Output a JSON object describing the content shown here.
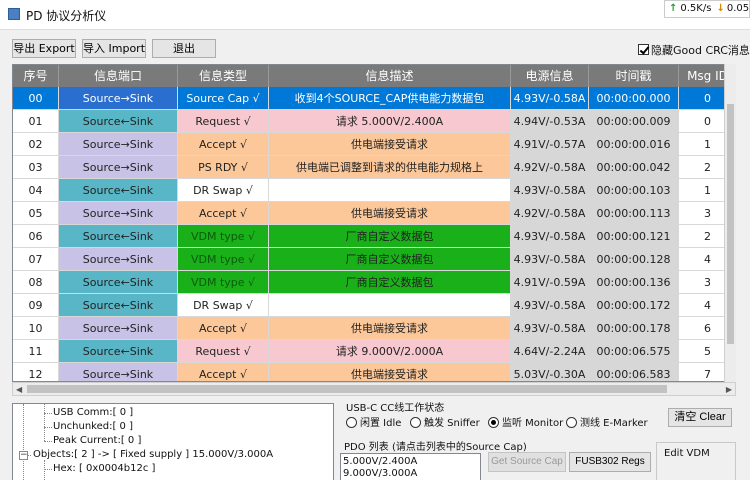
{
  "window": {
    "title": "PD 协议分析仪",
    "net_up": "0.5K/s",
    "net_down": "0.05"
  },
  "toolbar": {
    "export_label": "导出 Export",
    "import_label": "导入 Import",
    "exit_label": "退出",
    "hide_crc_label": "隐藏Good CRC消息",
    "hide_crc_checked": true
  },
  "table": {
    "columns": [
      "序号",
      "信息端口",
      "信息类型",
      "信息描述",
      "电源信息",
      "时间戳",
      "Msg ID"
    ],
    "rows": [
      {
        "no": "00",
        "port": "Source→Sink",
        "type": "Source Cap √",
        "desc": "收到4个SOURCE_CAP供电能力数据包",
        "power": "4.93V/-0.58A",
        "time": "00:00:00.000",
        "msg_id": "0",
        "selected": true
      },
      {
        "no": "01",
        "port": "Source←Sink",
        "type": "Request √",
        "desc": "请求 5.000V/2.400A",
        "power": "4.94V/-0.53A",
        "time": "00:00:00.009",
        "msg_id": "0"
      },
      {
        "no": "02",
        "port": "Source→Sink",
        "type": "Accept √",
        "desc": "供电端接受请求",
        "power": "4.91V/-0.57A",
        "time": "00:00:00.016",
        "msg_id": "1"
      },
      {
        "no": "03",
        "port": "Source→Sink",
        "type": "PS RDY √",
        "desc": "供电端已调整到请求的供电能力规格上",
        "power": "4.92V/-0.58A",
        "time": "00:00:00.042",
        "msg_id": "2"
      },
      {
        "no": "04",
        "port": "Source←Sink",
        "type": "DR Swap √",
        "desc": "",
        "power": "4.93V/-0.58A",
        "time": "00:00:00.103",
        "msg_id": "1"
      },
      {
        "no": "05",
        "port": "Source→Sink",
        "type": "Accept √",
        "desc": "供电端接受请求",
        "power": "4.92V/-0.58A",
        "time": "00:00:00.113",
        "msg_id": "3"
      },
      {
        "no": "06",
        "port": "Source←Sink",
        "type": "VDM type √",
        "desc": "厂商自定义数据包",
        "power": "4.93V/-0.58A",
        "time": "00:00:00.121",
        "msg_id": "2"
      },
      {
        "no": "07",
        "port": "Source→Sink",
        "type": "VDM type √",
        "desc": "厂商自定义数据包",
        "power": "4.93V/-0.58A",
        "time": "00:00:00.128",
        "msg_id": "4"
      },
      {
        "no": "08",
        "port": "Source←Sink",
        "type": "VDM type √",
        "desc": "厂商自定义数据包",
        "power": "4.91V/-0.59A",
        "time": "00:00:00.136",
        "msg_id": "3"
      },
      {
        "no": "09",
        "port": "Source←Sink",
        "type": "DR Swap √",
        "desc": "",
        "power": "4.93V/-0.58A",
        "time": "00:00:00.172",
        "msg_id": "4"
      },
      {
        "no": "10",
        "port": "Source→Sink",
        "type": "Accept √",
        "desc": "供电端接受请求",
        "power": "4.93V/-0.58A",
        "time": "00:00:00.178",
        "msg_id": "6"
      },
      {
        "no": "11",
        "port": "Source←Sink",
        "type": "Request √",
        "desc": "请求 9.000V/2.000A",
        "power": "4.64V/-2.24A",
        "time": "00:00:06.575",
        "msg_id": "5"
      },
      {
        "no": "12",
        "port": "Source→Sink",
        "type": "Accept √",
        "desc": "供电端接受请求",
        "power": "5.03V/-0.30A",
        "time": "00:00:06.583",
        "msg_id": "7"
      }
    ]
  },
  "colors": {
    "header_bg": "#7a7a7a",
    "selected_bg": "#0078d7",
    "port_to_sink": "#c7c2e6",
    "port_from_sink": "#59b6c6",
    "type_source_cap": "#0078d7",
    "type_request": "#f8c8d0",
    "type_accept": "#fcc89a",
    "type_ps_rdy": "#fcc89a",
    "type_vdm": "#1ab01a",
    "type_dr_swap": "#ffffff",
    "desc_source_cap": "#0078d7",
    "desc_request": "#f8c8d0",
    "desc_accept": "#fcc89a",
    "desc_ps_rdy": "#fcc89a",
    "desc_vdm": "#1ab01a",
    "power_bg": "#d7d7d7"
  },
  "tree": {
    "lines": [
      "USB Comm:[ 0 ]",
      "Unchunked:[ 0 ]",
      "Peak Current:[ 0 ]",
      "Objects:[ 2 ] -> [ Fixed supply ] 15.000V/3.000A",
      "Hex: [ 0x0004b12c ]"
    ]
  },
  "cc_status": {
    "title": "USB-C CC线工作状态",
    "options": [
      {
        "label": "闲置 Idle",
        "selected": false
      },
      {
        "label": "触发 Sniffer",
        "selected": false
      },
      {
        "label": "监听 Monitor",
        "selected": true
      },
      {
        "label": "测线 E-Marker",
        "selected": false
      }
    ],
    "clear_label": "清空 Clear"
  },
  "pdo": {
    "title": "PDO 列表 (请点击列表中的Source Cap)",
    "items": [
      "5.000V/2.400A",
      "9.000V/3.000A"
    ],
    "get_source_cap_label": "Get Source Cap",
    "fusb_regs_label": "FUSB302 Regs"
  },
  "vdm": {
    "title": "Edit VDM"
  }
}
